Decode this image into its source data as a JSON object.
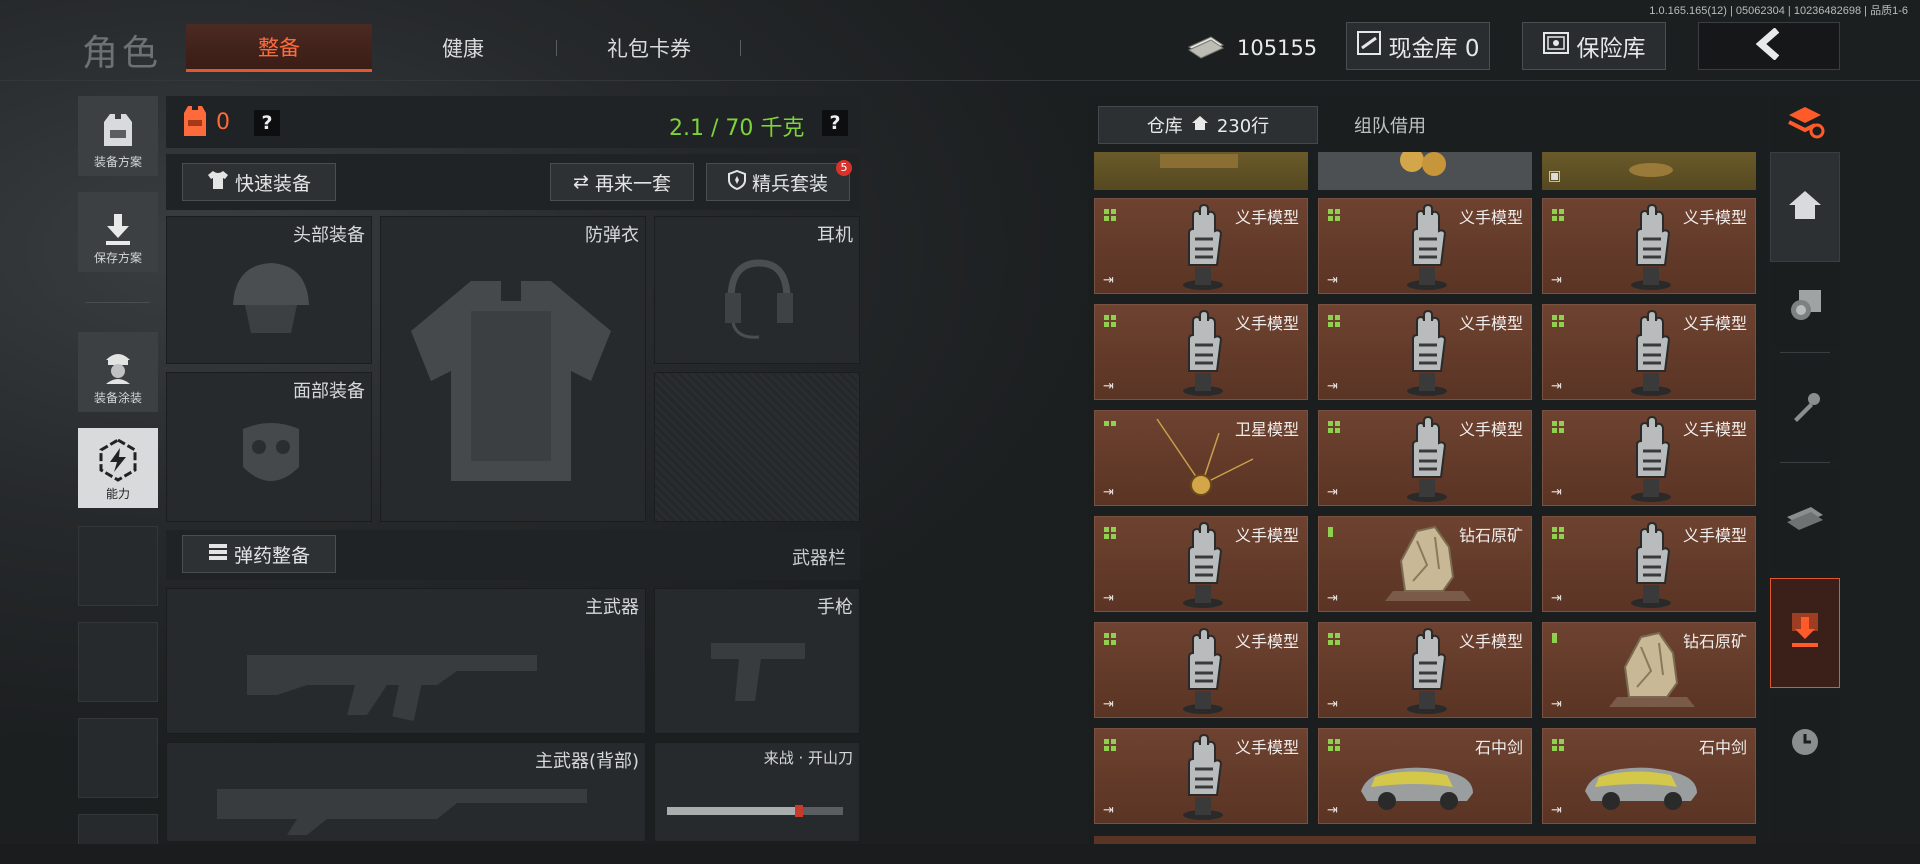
{
  "version": "1.0.165.165(12) | 05062304 | 10236482698 | 品质1-6",
  "title": "角色",
  "tabs": [
    "整备",
    "健康",
    "礼包卡券"
  ],
  "money": "105155",
  "cash_vault": "现金库 0",
  "insurance_vault": "保险库",
  "left_nav": [
    "装备方案",
    "保存方案",
    "装备涂装",
    "能力"
  ],
  "armor_count": "0",
  "help_mark": "?",
  "weight": "2.1 / 70 千克",
  "quick_equip": "快速装备",
  "again_set": "再来一套",
  "elite_set": "精兵套装",
  "elite_badge": "5",
  "slots": {
    "head": "头部装备",
    "armor": "防弹衣",
    "headset": "耳机",
    "face": "面部装备",
    "primary": "主武器",
    "pistol": "手枪",
    "primary_back": "主武器(背部)",
    "melee": "来战 · 开山刀"
  },
  "ammo_btn": "弹药整备",
  "weapon_bar": "武器栏",
  "warehouse_tab": "仓库",
  "warehouse_rows": "230行",
  "team_borrow": "组队借用",
  "items": [
    {
      "name": "义手模型",
      "dots": 4
    },
    {
      "name": "义手模型",
      "dots": 4
    },
    {
      "name": "义手模型",
      "dots": 4
    },
    {
      "name": "义手模型",
      "dots": 4
    },
    {
      "name": "义手模型",
      "dots": 4
    },
    {
      "name": "义手模型",
      "dots": 4
    },
    {
      "name": "卫星模型",
      "dots": 2
    },
    {
      "name": "义手模型",
      "dots": 4
    },
    {
      "name": "义手模型",
      "dots": 4
    },
    {
      "name": "义手模型",
      "dots": 4
    },
    {
      "name": "钻石原矿",
      "dots": 1
    },
    {
      "name": "义手模型",
      "dots": 4
    },
    {
      "name": "义手模型",
      "dots": 4
    },
    {
      "name": "义手模型",
      "dots": 4
    },
    {
      "name": "钻石原矿",
      "dots": 1
    },
    {
      "name": "义手模型",
      "dots": 4
    },
    {
      "name": "石中剑",
      "dots": 4
    },
    {
      "name": "石中剑",
      "dots": 4
    }
  ],
  "colors": {
    "accent": "#ff6a3a",
    "weight": "#7ed23a",
    "item_bg": "#6e4230",
    "dot": "#8fd14f"
  }
}
